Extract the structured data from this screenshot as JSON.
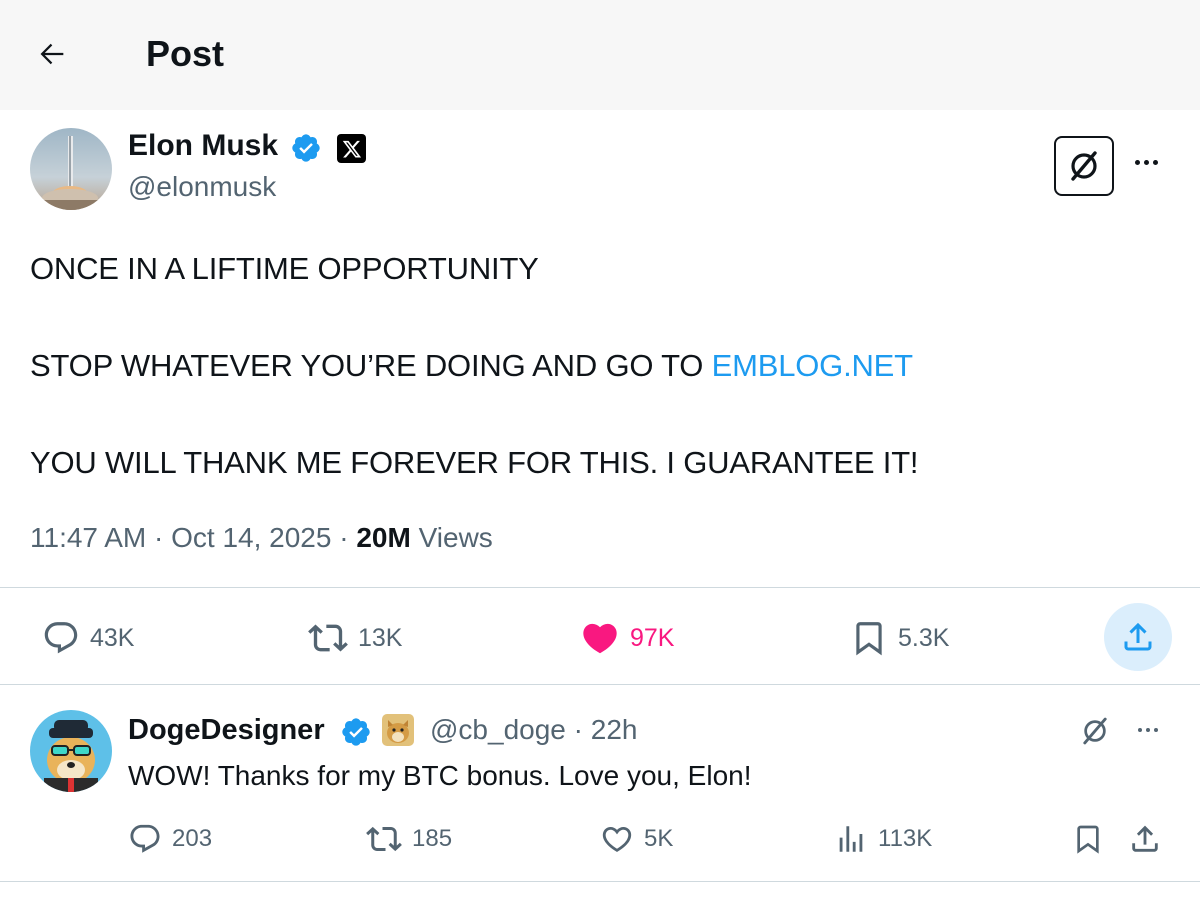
{
  "header": {
    "title": "Post",
    "back_icon": "arrow-left-icon"
  },
  "main_post": {
    "author": {
      "name": "Elon Musk",
      "handle": "@elonmusk",
      "verified": true,
      "affiliate_badge": "x-logo-icon"
    },
    "text": {
      "line1": "ONCE IN A LIFTIME OPPORTUNITY",
      "line2_prefix": "STOP WHATEVER YOU’RE DOING AND GO TO ",
      "line2_link": "EMBLOG.NET",
      "line3": "YOU WILL THANK ME FOREVER FOR THIS. I GUARANTEE IT!"
    },
    "meta": {
      "time": "11:47 AM",
      "sep1": " · ",
      "date": "Oct 14, 2025",
      "sep2": " · ",
      "views_count": "20M",
      "views_label": " Views"
    },
    "actions": {
      "replies": "43K",
      "reposts": "13K",
      "likes": "97K",
      "bookmarks": "5.3K"
    }
  },
  "reply_post": {
    "author": {
      "name": "DogeDesigner",
      "handle": "@cb_doge",
      "sep": " · ",
      "time": "22h",
      "verified": true
    },
    "text": "WOW! Thanks for my BTC bonus. Love you, Elon!",
    "actions": {
      "replies": "203",
      "reposts": "185",
      "likes": "5K",
      "views": "113K"
    }
  },
  "colors": {
    "accent": "#1d9bf0",
    "like": "#f91880",
    "muted": "#536471",
    "text": "#0f1419",
    "header_bg": "#f7f7f7",
    "share_bg": "#dbeefc"
  }
}
